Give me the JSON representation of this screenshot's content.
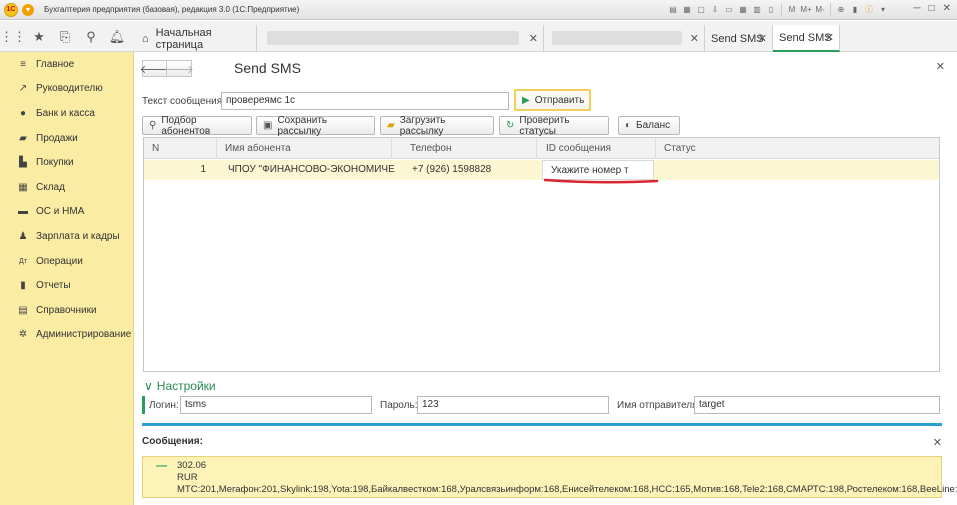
{
  "window": {
    "title": "Бухгалтерия предприятия (базовая), редакция 3.0  (1С:Предприятие)",
    "logo_text": "1С"
  },
  "tabs": [
    {
      "label": "Начальная страница"
    },
    {
      "label": "Send SMS"
    },
    {
      "label": "Send SMS"
    }
  ],
  "sidebar": {
    "items": [
      {
        "label": "Главное",
        "icon": "menu-lines-icon"
      },
      {
        "label": "Руководителю",
        "icon": "trend-icon"
      },
      {
        "label": "Банк и касса",
        "icon": "coin-icon"
      },
      {
        "label": "Продажи",
        "icon": "basket-icon"
      },
      {
        "label": "Покупки",
        "icon": "cart-icon"
      },
      {
        "label": "Склад",
        "icon": "warehouse-icon"
      },
      {
        "label": "ОС и НМА",
        "icon": "truck-icon"
      },
      {
        "label": "Зарплата и кадры",
        "icon": "person-icon"
      },
      {
        "label": "Операции",
        "icon": "dt-kt-icon"
      },
      {
        "label": "Отчеты",
        "icon": "bar-chart-icon"
      },
      {
        "label": "Справочники",
        "icon": "book-icon"
      },
      {
        "label": "Администрирование",
        "icon": "gear-icon"
      }
    ]
  },
  "form": {
    "title": "Send SMS",
    "message_label": "Текст сообщения:",
    "message_value": "провереямс 1с",
    "send_button": "Отправить",
    "toolbar": {
      "pick_subscribers": "Подбор абонентов",
      "save_mailing": "Сохранить рассылку",
      "load_mailing": "Загрузить рассылку",
      "check_statuses": "Проверить статусы",
      "balance": "Баланс"
    },
    "table": {
      "columns": [
        "N",
        "Имя абонента",
        "Телефон",
        "ID сообщения",
        "Статус"
      ],
      "rows": [
        {
          "n": "1",
          "name": "ЧПОУ \"ФИНАНСОВО-ЭКОНОМИЧЕ",
          "phone": "+7 (926) 1598828",
          "id": "Укажите номер т",
          "status": ""
        }
      ]
    },
    "settings": {
      "header": "Настройки",
      "login_label": "Логин:",
      "login_value": "tsms",
      "password_label": "Пароль:",
      "password_value": "123",
      "sender_label": "Имя отправителя:",
      "sender_value": "target"
    }
  },
  "messages": {
    "title": "Сообщения:",
    "lines": [
      "302.06",
      "RUR",
      "МТС:201,Мегафон:201,Skylink:198,Yota:198,Байкалвестком:168,Уралсвязьинформ:168,Енисейтелеком:168,НСС:165,Мотив:168,Tele2:168,СМАРТС:198,Ростелеком:168,BeeLine:2..."
    ]
  },
  "colors": {
    "sidebar_bg": "#fbeca4",
    "accent_green": "#2a9d5c",
    "messages_bar": "#2aa0d0",
    "row_highlight": "#fdf6d3",
    "annotation_red": "#d8262e"
  }
}
